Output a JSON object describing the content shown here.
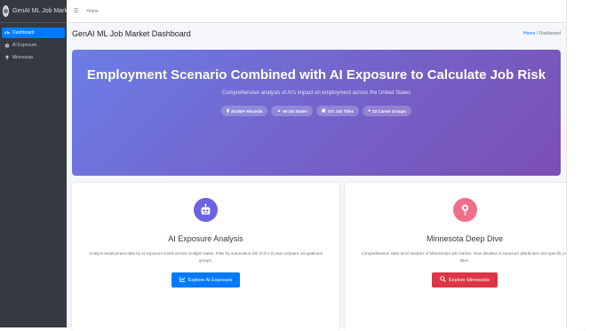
{
  "app": {
    "brand": "GenAI ML Job Market"
  },
  "sidebar": {
    "items": [
      {
        "label": "Dashboard",
        "icon": "dashboard-icon"
      },
      {
        "label": "AI Exposure",
        "icon": "robot-icon"
      },
      {
        "label": "Minnesota",
        "icon": "map-pin-icon"
      }
    ]
  },
  "topbar": {
    "home_link": "Home"
  },
  "header": {
    "title": "GenAI ML Job Market Dashboard",
    "breadcrumb_home": "Home",
    "breadcrumb_separator": "/",
    "breadcrumb_current": "Dashboard"
  },
  "hero": {
    "title": "Employment Scenario Combined with AI Exposure to Calculate Job Risk",
    "subtitle": "Comprehensive analysis of AI's impact on employment across the United States",
    "stats": [
      {
        "label": "30,000+ Records",
        "icon": "database-icon"
      },
      {
        "label": "50 US States",
        "icon": "building-icon"
      },
      {
        "label": "737 Job Titles",
        "icon": "briefcase-icon"
      },
      {
        "label": "22 Career Groups",
        "icon": "group-icon"
      }
    ]
  },
  "cards": {
    "ai_exposure": {
      "title": "AI Exposure Analysis",
      "description": "Analyze employment data by AI exposure levels across multiple states. Filter by automation risk (0.0-1.0) and compare occupational groups.",
      "button": "Explore AI Exposure",
      "icon": "robot-icon",
      "accent": "#6c63e0"
    },
    "minnesota": {
      "title": "Minnesota Deep Dive",
      "description": "Comprehensive state-level analysis of Minnesota's job market. View detailed AI exposure distribution and specific job titles.",
      "button": "Explore Minnesota",
      "icon": "map-pin-icon",
      "accent": "#ef6e89"
    }
  },
  "colors": {
    "sidebar_bg": "#343a40",
    "primary": "#007bff",
    "danger": "#dc3545",
    "hero_gradient_start": "#6b7de6",
    "hero_gradient_end": "#7b4fb4"
  }
}
